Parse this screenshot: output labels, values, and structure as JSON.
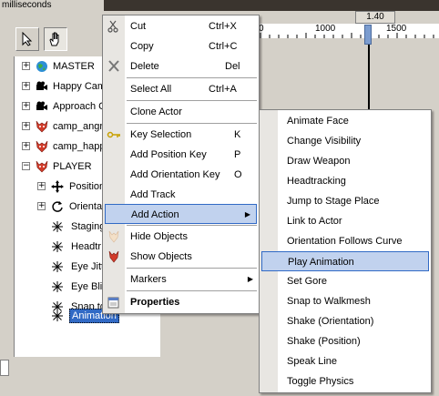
{
  "header": {
    "units_label": "milliseconds",
    "current_time": "1.40"
  },
  "ruler": {
    "ticks": [
      "0",
      "1000",
      "1500"
    ],
    "partial_tick": "0"
  },
  "tree": {
    "items": [
      {
        "label": "MASTER",
        "icon": "globe-icon"
      },
      {
        "label": "Happy Cam",
        "icon": "camera-icon"
      },
      {
        "label": "Approach C",
        "icon": "camera-icon"
      },
      {
        "label": "camp_angr",
        "icon": "actor-icon"
      },
      {
        "label": "camp_happ",
        "icon": "actor-icon"
      },
      {
        "label": "PLAYER",
        "icon": "actor-icon"
      },
      {
        "label": "Position",
        "icon": "move-icon"
      },
      {
        "label": "Orientat",
        "icon": "rotate-icon"
      },
      {
        "label": "Staging",
        "icon": "asterisk-icon"
      },
      {
        "label": "Headtr",
        "icon": "asterisk-icon"
      },
      {
        "label": "Eye Jitt",
        "icon": "asterisk-icon"
      },
      {
        "label": "Eye Blin",
        "icon": "asterisk-icon"
      },
      {
        "label": "Snap to",
        "icon": "asterisk-icon"
      },
      {
        "label": "Animation",
        "icon": "asterisk-icon"
      }
    ]
  },
  "context_menu": {
    "items": [
      {
        "label": "Cut",
        "shortcut": "Ctrl+X",
        "icon": "scissors-icon"
      },
      {
        "label": "Copy",
        "shortcut": "Ctrl+C",
        "icon": ""
      },
      {
        "label": "Delete",
        "shortcut": "Del",
        "icon": "delete-x-icon"
      },
      {
        "label": "Select All",
        "shortcut": "Ctrl+A",
        "icon": ""
      },
      {
        "label": "Clone Actor",
        "shortcut": "",
        "icon": ""
      },
      {
        "label": "Key Selection",
        "shortcut": "K",
        "icon": "key-icon"
      },
      {
        "label": "Add Position Key",
        "shortcut": "P",
        "icon": ""
      },
      {
        "label": "Add Orientation Key",
        "shortcut": "O",
        "icon": ""
      },
      {
        "label": "Add Track",
        "shortcut": "",
        "icon": ""
      },
      {
        "label": "Add Action",
        "shortcut": "",
        "icon": ""
      },
      {
        "label": "Hide Objects",
        "shortcut": "",
        "icon": "hide-icon"
      },
      {
        "label": "Show Objects",
        "shortcut": "",
        "icon": "show-icon"
      },
      {
        "label": "Markers",
        "shortcut": "",
        "icon": ""
      },
      {
        "label": "Properties",
        "shortcut": "",
        "icon": "properties-icon"
      }
    ]
  },
  "submenu": {
    "items": [
      "Animate Face",
      "Change Visibility",
      "Draw Weapon",
      "Headtracking",
      "Jump to Stage Place",
      "Link to Actor",
      "Orientation Follows Curve",
      "Play Animation",
      "Set Gore",
      "Snap to Walkmesh",
      "Shake (Orientation)",
      "Shake (Position)",
      "Speak Line",
      "Toggle Physics"
    ]
  },
  "colors": {
    "highlight_fill": "#c1d2ee",
    "highlight_border": "#316ac5",
    "selection": "#316ac5"
  }
}
